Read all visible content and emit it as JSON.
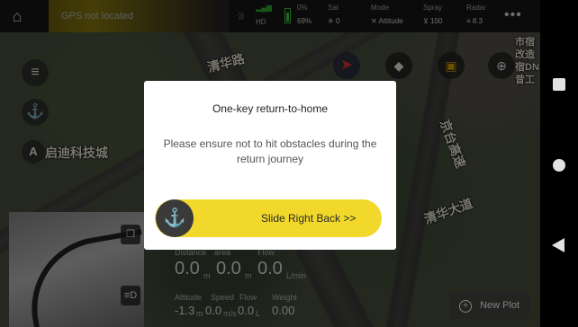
{
  "status_bar": {
    "gps_text": "GPS not located",
    "hd_label": "HD",
    "battery_pct_top": "0%",
    "battery_pct_bottom": "69%",
    "sat_label": "Sat",
    "sat_value": "0",
    "mode_label": "Mode",
    "mode_value": "Attitude",
    "spray_label": "Spray",
    "spray_value": "100",
    "radar_label": "Radar",
    "radar_value": "8.3"
  },
  "map": {
    "labels": [
      "清华路",
      "启迪科技城",
      "清华大道",
      "京台高速",
      "市宿",
      "改造",
      "宿DN",
      "昔工"
    ]
  },
  "telemetry": {
    "distance_label": "Distance",
    "area_label": "area",
    "flow_label": "Flow",
    "distance_value": "0.0",
    "distance_unit": "m",
    "area_value": "0.0",
    "area_unit": "m",
    "flow_value": "0.0",
    "flow_unit": "L/min",
    "altitude_label": "Altitude",
    "speed_label": "Speed",
    "flow2_label": "Flow",
    "weight_label": "Weight",
    "altitude_value": "-1.3",
    "altitude_unit": "m",
    "speed_value": "0.0",
    "speed_unit": "m/s",
    "flow2_value": "0.0",
    "flow2_unit": "L",
    "weight_value": "0.00"
  },
  "new_plot": {
    "label": "New Plot"
  },
  "dialog": {
    "title": "One-key return-to-home",
    "message": "Please ensure not to hit obstacles during the return journey",
    "slider_label": "Slide Right Back >>"
  },
  "icons": {
    "home": "home-icon",
    "menu": "menu-icon",
    "return_home": "return-home-icon",
    "compass": "compass-icon",
    "eraser": "eraser-icon",
    "layers": "layers-icon",
    "locate": "locate-icon",
    "camera_switch": "camera-switch-icon",
    "add": "add-icon"
  },
  "colors": {
    "accent": "#f1d82a",
    "gps_block": "#8a7b10",
    "dialog_bg": "#ffffff"
  }
}
